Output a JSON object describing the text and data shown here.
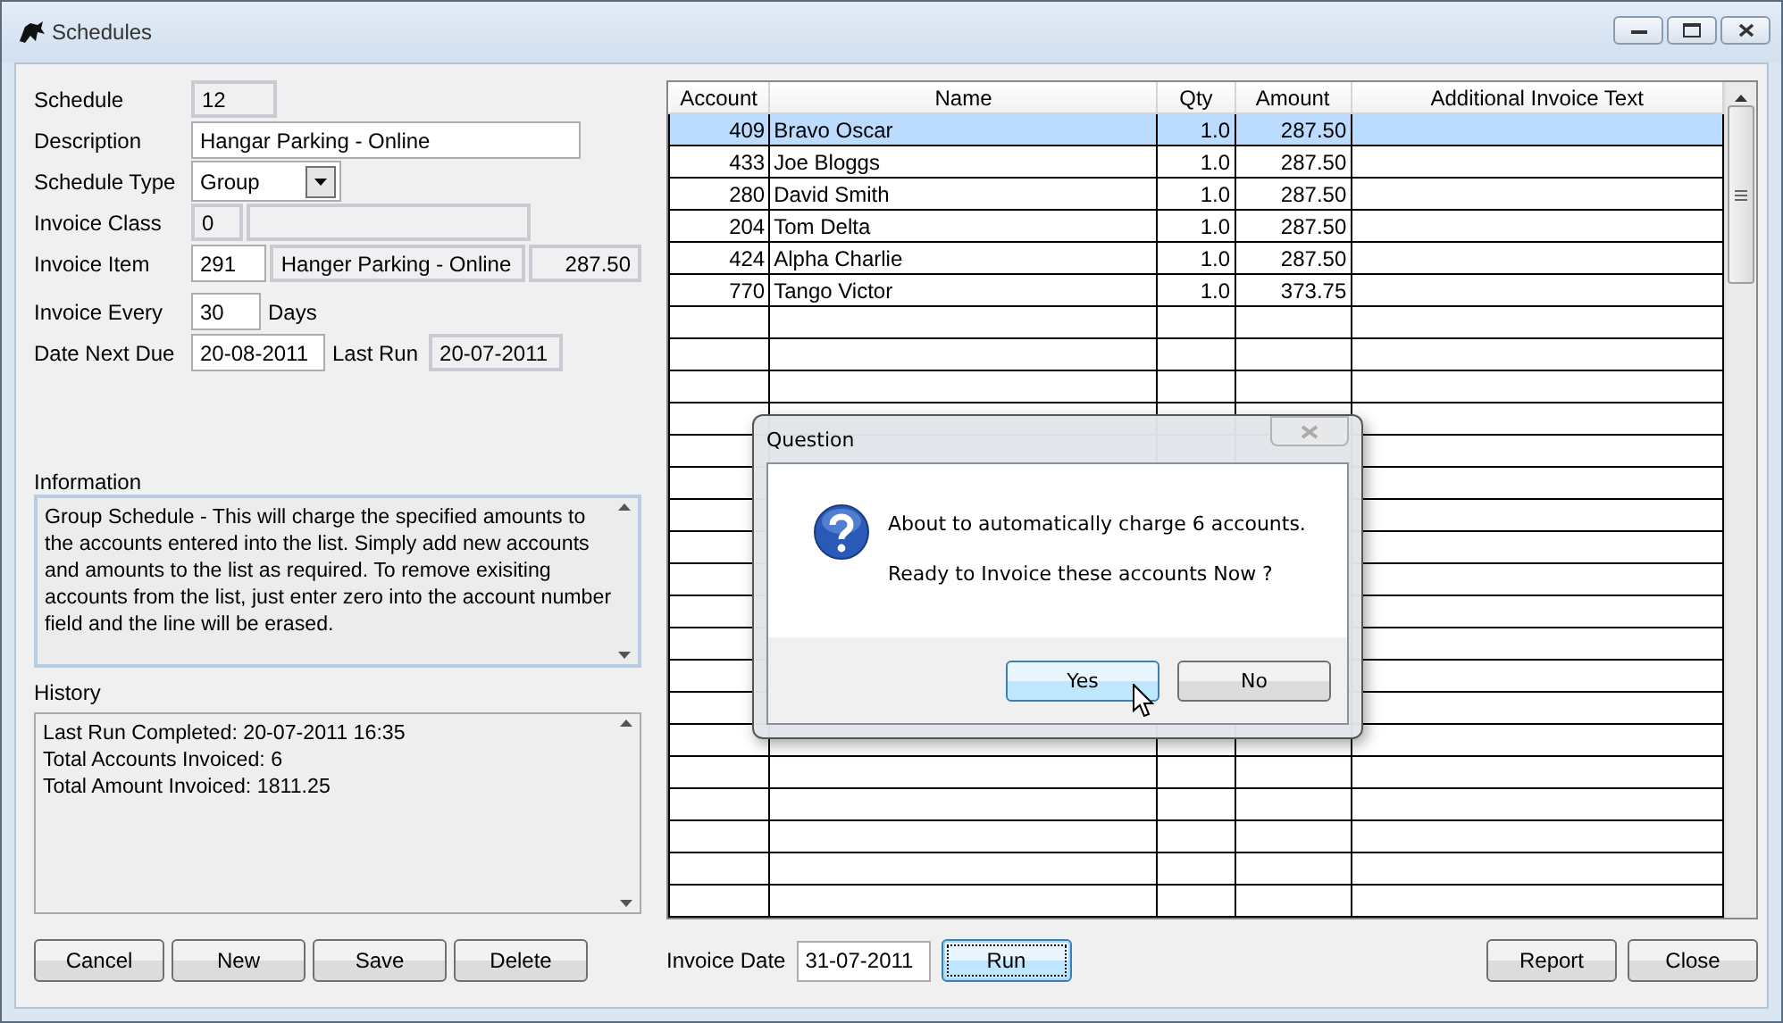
{
  "window": {
    "title": "Schedules"
  },
  "form": {
    "schedule": {
      "label": "Schedule",
      "value": "12",
      "readonly": true
    },
    "description": {
      "label": "Description",
      "value": "Hangar Parking - Online",
      "readonly": false
    },
    "schedule_type": {
      "label": "Schedule Type",
      "value": "Group"
    },
    "invoice_class": {
      "label": "Invoice Class",
      "code": {
        "value": "0",
        "readonly": true
      },
      "name": {
        "readonly": true
      }
    },
    "invoice_item": {
      "label": "Invoice Item",
      "code": {
        "value": "291",
        "readonly": false
      },
      "name": {
        "value": "Hanger Parking - Online",
        "readonly": true
      },
      "price": {
        "value": "287.50",
        "readonly": true
      }
    },
    "invoice_every": {
      "label": "Invoice Every",
      "value": "30",
      "readonly": false,
      "unit": "Days"
    },
    "date_next_due": {
      "label": "Date Next Due",
      "value": "20-08-2011",
      "readonly": false
    },
    "last_run": {
      "label": "Last Run",
      "value": "20-07-2011",
      "readonly": true
    }
  },
  "information": {
    "label": "Information",
    "text": "Group Schedule - This will charge the specified amounts to the accounts entered into the list. Simply add new accounts and amounts to the list as required. To remove exisiting accounts from the list, just enter zero into the account number field and the line will be erased."
  },
  "history": {
    "label": "History",
    "lines": [
      "Last Run Completed: 20-07-2011 16:35",
      "Total Accounts Invoiced: 6",
      "Total Amount Invoiced: 1811.25"
    ]
  },
  "left_buttons": [
    {
      "label": "Cancel",
      "focused": false
    },
    {
      "label": "New",
      "focused": false
    },
    {
      "label": "Save",
      "focused": false
    },
    {
      "label": "Delete",
      "focused": false
    }
  ],
  "table": {
    "columns": [
      "Account",
      "Name",
      "Qty",
      "Amount",
      "Additional Invoice Text"
    ],
    "rows": [
      {
        "account": "409",
        "name": "Bravo Oscar",
        "qty": "1.0",
        "amount": "287.50",
        "selected": true
      },
      {
        "account": "433",
        "name": "Joe Bloggs",
        "qty": "1.0",
        "amount": "287.50",
        "selected": false
      },
      {
        "account": "280",
        "name": "David Smith",
        "qty": "1.0",
        "amount": "287.50",
        "selected": false
      },
      {
        "account": "204",
        "name": "Tom Delta",
        "qty": "1.0",
        "amount": "287.50",
        "selected": false
      },
      {
        "account": "424",
        "name": "Alpha Charlie",
        "qty": "1.0",
        "amount": "287.50",
        "selected": false
      },
      {
        "account": "770",
        "name": "Tango Victor",
        "qty": "1.0",
        "amount": "373.75",
        "selected": false
      }
    ]
  },
  "invoice_date": {
    "label": "Invoice Date",
    "value": "31-07-2011"
  },
  "right_buttons": [
    {
      "label": "Run",
      "focused": true
    },
    {
      "label": "Report",
      "focused": false
    },
    {
      "label": "Close",
      "focused": false
    }
  ],
  "dialog": {
    "title": "Question",
    "lines": [
      "About to automatically charge 6 accounts.",
      "Ready to Invoice these accounts Now ?"
    ],
    "buttons": [
      {
        "label": "Yes",
        "selected": true
      },
      {
        "label": "No",
        "selected": false
      }
    ]
  }
}
